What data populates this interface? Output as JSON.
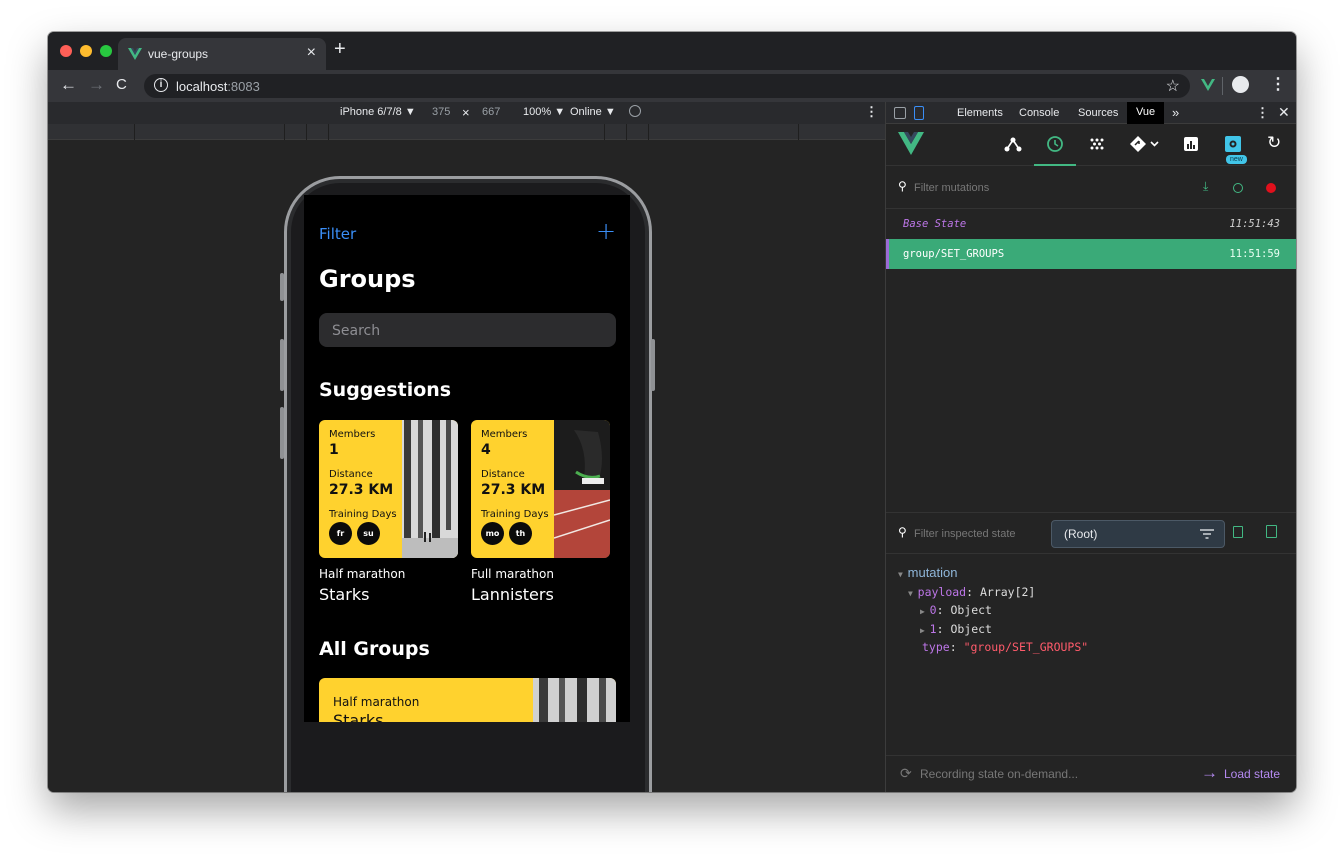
{
  "browser": {
    "tab_title": "vue-groups",
    "tab_close": "×",
    "new_tab": "+",
    "url_host": "localhost",
    "url_port": ":8083"
  },
  "device_toolbar": {
    "device": "iPhone 6/7/8 ▼",
    "width": "375",
    "times": "×",
    "height": "667",
    "zoom": "100% ▼",
    "network": "Online ▼"
  },
  "app": {
    "filter_label": "Filter",
    "add_label": "+",
    "title": "Groups",
    "search_placeholder": "Search",
    "suggestions_heading": "Suggestions",
    "suggestions": [
      {
        "members_label": "Members",
        "members": "1",
        "distance_label": "Distance",
        "distance": "27.3 KM",
        "training_label": "Training Days",
        "days": [
          "fr",
          "su"
        ],
        "type": "Half marathon",
        "name": "Starks"
      },
      {
        "members_label": "Members",
        "members": "4",
        "distance_label": "Distance",
        "distance": "27.3 KM",
        "training_label": "Training Days",
        "days": [
          "mo",
          "th"
        ],
        "type": "Full marathon",
        "name": "Lannisters"
      }
    ],
    "all_groups_heading": "All Groups",
    "all_groups": [
      {
        "type": "Half marathon",
        "name": "Starks"
      }
    ]
  },
  "devtools": {
    "tabs": [
      "Elements",
      "Console",
      "Sources",
      "Vue",
      "»"
    ],
    "active_tab": "Vue",
    "new_badge": "new",
    "filter_mutations_placeholder": "Filter mutations",
    "mutations": [
      {
        "name": "Base State",
        "time": "11:51:43"
      },
      {
        "name": "group/SET_GROUPS",
        "time": "11:51:59"
      }
    ],
    "filter_state_placeholder": "Filter inspected state",
    "root_select": "(Root)",
    "tree": {
      "mutation": "mutation",
      "payload_key": "payload",
      "payload_val": "Array[2]",
      "item0_key": "0",
      "item0_val": "Object",
      "item1_key": "1",
      "item1_val": "Object",
      "type_key": "type",
      "type_val": "\"group/SET_GROUPS\""
    },
    "recording": "Recording state on-demand...",
    "load_state": "Load state"
  }
}
